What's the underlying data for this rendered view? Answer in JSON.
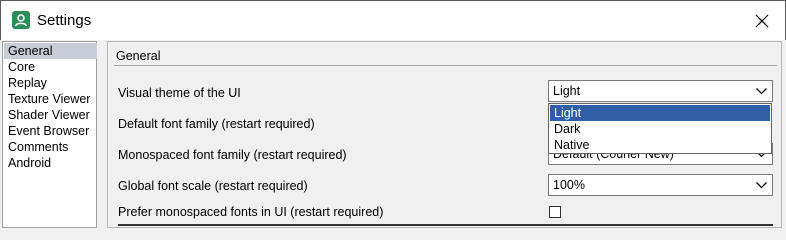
{
  "window": {
    "title": "Settings"
  },
  "sidebar": {
    "items": [
      {
        "label": "General",
        "selected": true
      },
      {
        "label": "Core",
        "selected": false
      },
      {
        "label": "Replay",
        "selected": false
      },
      {
        "label": "Texture Viewer",
        "selected": false
      },
      {
        "label": "Shader Viewer",
        "selected": false
      },
      {
        "label": "Event Browser",
        "selected": false
      },
      {
        "label": "Comments",
        "selected": false
      },
      {
        "label": "Android",
        "selected": false
      }
    ]
  },
  "general": {
    "group_title": "General",
    "theme": {
      "label": "Visual theme of the UI",
      "value": "Light",
      "options": [
        "Light",
        "Dark",
        "Native"
      ],
      "highlighted": "Light"
    },
    "default_font": {
      "label": "Default font family (restart required)"
    },
    "mono_font": {
      "label": "Monospaced font family (restart required)",
      "value": "Default (Courier New)"
    },
    "font_scale": {
      "label": "Global font scale (restart required)",
      "value": "100%"
    },
    "prefer_mono": {
      "label": "Prefer monospaced fonts in UI (restart required)",
      "checked": false
    }
  },
  "icons": {
    "app": "person-icon",
    "close": "close-icon",
    "combo": "chevron-down-icon"
  },
  "colors": {
    "selection": "#2f5fa6",
    "sidebar_selected": "#c8ccd6",
    "app_icon": "#2e8b57"
  }
}
